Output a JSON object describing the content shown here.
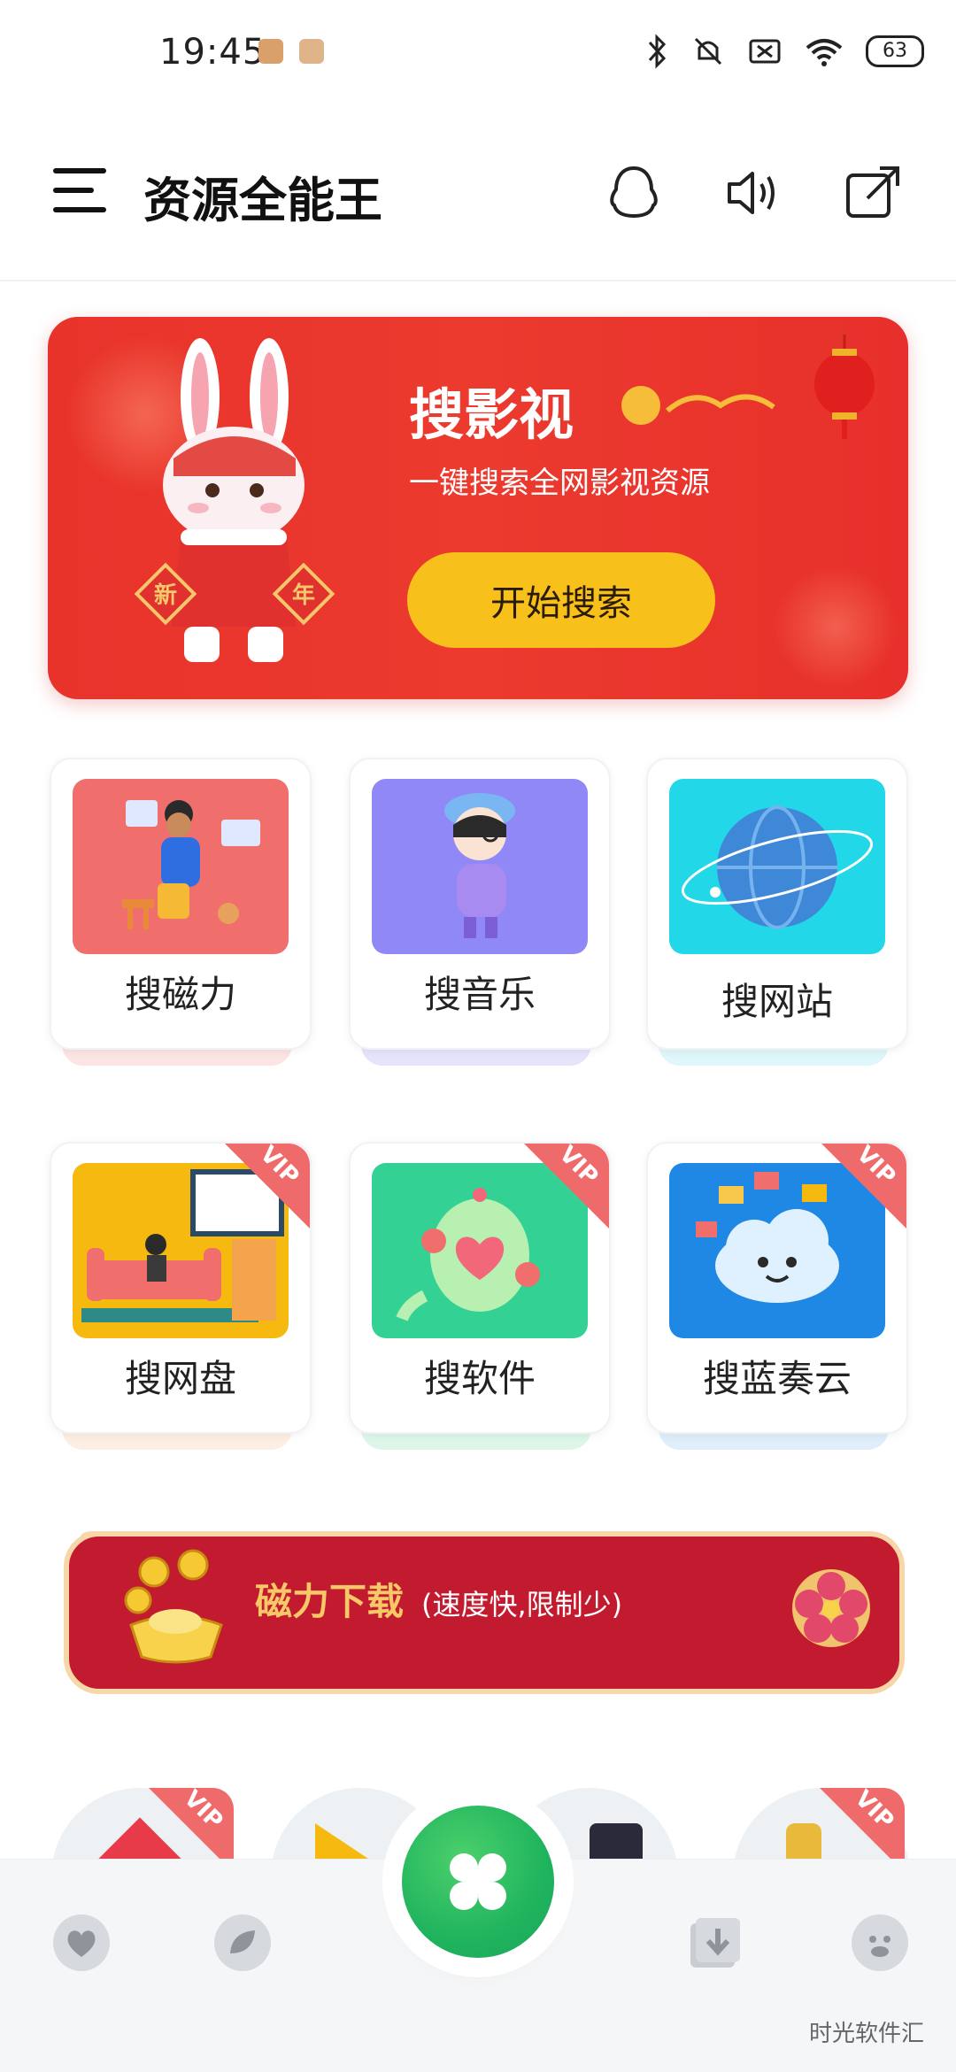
{
  "status_bar": {
    "time": "19:45",
    "battery": "63"
  },
  "header": {
    "title": "资源全能王"
  },
  "banner": {
    "title": "搜影视",
    "subtitle": "一键搜索全网影视资源",
    "button": "开始搜索",
    "badges": [
      "新",
      "年"
    ]
  },
  "tiles": [
    {
      "label": "搜磁力",
      "vip": false,
      "color": "#f06e6b"
    },
    {
      "label": "搜音乐",
      "vip": false,
      "color": "#9088f7"
    },
    {
      "label": "搜网站",
      "vip": false,
      "color": "#22d7e8"
    },
    {
      "label": "搜网盘",
      "vip": true,
      "color": "#f6b90f"
    },
    {
      "label": "搜软件",
      "vip": true,
      "color": "#33d194"
    },
    {
      "label": "搜蓝奏云",
      "vip": true,
      "color": "#1f88e5"
    }
  ],
  "vip_label": "VIP",
  "magnet_banner": {
    "title": "磁力下载",
    "subtitle": "(速度快,限制少)"
  },
  "bottom_nav": {
    "items": [
      "heart",
      "leaf",
      "grid",
      "download",
      "profile"
    ]
  },
  "watermark": "时光软件汇",
  "colors": {
    "accent_green": "#20b45e",
    "banner_red": "#e8332b",
    "button_yellow": "#f8c01a"
  }
}
